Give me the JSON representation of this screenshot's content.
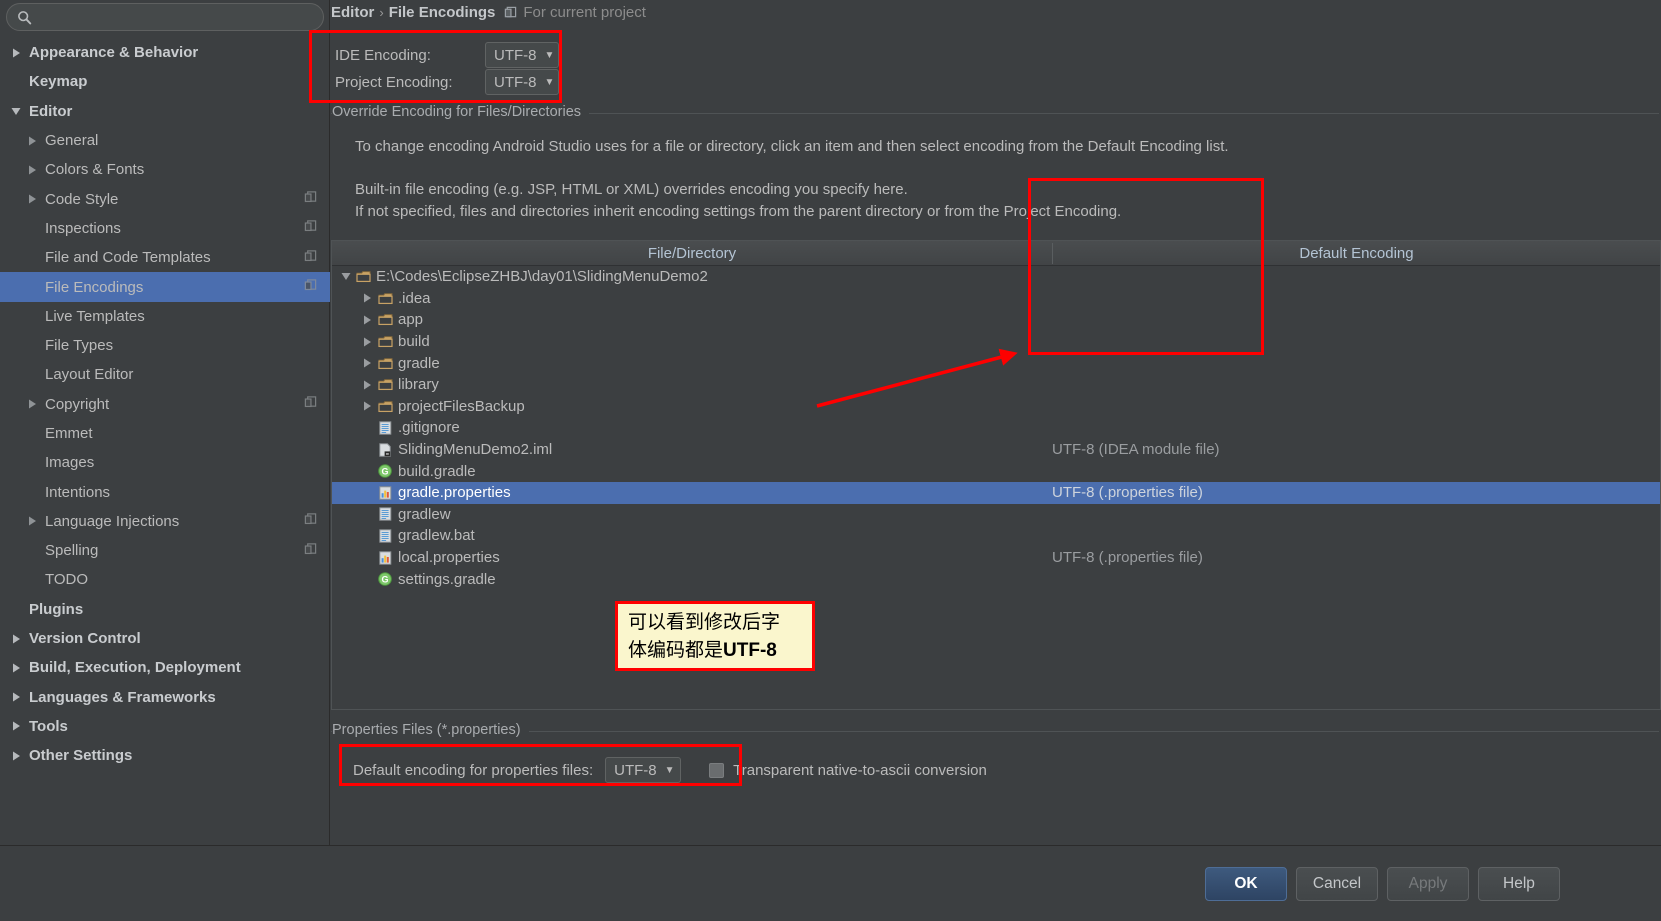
{
  "search": {
    "value": "",
    "placeholder": "",
    "icon": "search-icon"
  },
  "sidebar": {
    "items": [
      {
        "label": "Appearance & Behavior",
        "level": 0,
        "arrow": "right",
        "bold": true,
        "badge": false
      },
      {
        "label": "Keymap",
        "level": 0,
        "arrow": "none",
        "bold": true,
        "badge": false
      },
      {
        "label": "Editor",
        "level": 0,
        "arrow": "down",
        "bold": true,
        "badge": false
      },
      {
        "label": "General",
        "level": 1,
        "arrow": "right",
        "bold": false,
        "badge": false
      },
      {
        "label": "Colors & Fonts",
        "level": 1,
        "arrow": "right",
        "bold": false,
        "badge": false
      },
      {
        "label": "Code Style",
        "level": 1,
        "arrow": "right",
        "bold": false,
        "badge": true
      },
      {
        "label": "Inspections",
        "level": 1,
        "arrow": "none",
        "bold": false,
        "badge": true
      },
      {
        "label": "File and Code Templates",
        "level": 1,
        "arrow": "none",
        "bold": false,
        "badge": true
      },
      {
        "label": "File Encodings",
        "level": 1,
        "arrow": "none",
        "bold": false,
        "badge": true,
        "selected": true
      },
      {
        "label": "Live Templates",
        "level": 1,
        "arrow": "none",
        "bold": false,
        "badge": false
      },
      {
        "label": "File Types",
        "level": 1,
        "arrow": "none",
        "bold": false,
        "badge": false
      },
      {
        "label": "Layout Editor",
        "level": 1,
        "arrow": "none",
        "bold": false,
        "badge": false
      },
      {
        "label": "Copyright",
        "level": 1,
        "arrow": "right",
        "bold": false,
        "badge": true
      },
      {
        "label": "Emmet",
        "level": 1,
        "arrow": "none",
        "bold": false,
        "badge": false
      },
      {
        "label": "Images",
        "level": 1,
        "arrow": "none",
        "bold": false,
        "badge": false
      },
      {
        "label": "Intentions",
        "level": 1,
        "arrow": "none",
        "bold": false,
        "badge": false
      },
      {
        "label": "Language Injections",
        "level": 1,
        "arrow": "right",
        "bold": false,
        "badge": true
      },
      {
        "label": "Spelling",
        "level": 1,
        "arrow": "none",
        "bold": false,
        "badge": true
      },
      {
        "label": "TODO",
        "level": 1,
        "arrow": "none",
        "bold": false,
        "badge": false
      },
      {
        "label": "Plugins",
        "level": 0,
        "arrow": "none",
        "bold": true,
        "badge": false
      },
      {
        "label": "Version Control",
        "level": 0,
        "arrow": "right",
        "bold": true,
        "badge": false
      },
      {
        "label": "Build, Execution, Deployment",
        "level": 0,
        "arrow": "right",
        "bold": true,
        "badge": false
      },
      {
        "label": "Languages & Frameworks",
        "level": 0,
        "arrow": "right",
        "bold": true,
        "badge": false
      },
      {
        "label": "Tools",
        "level": 0,
        "arrow": "right",
        "bold": true,
        "badge": false
      },
      {
        "label": "Other Settings",
        "level": 0,
        "arrow": "right",
        "bold": true,
        "badge": false
      }
    ]
  },
  "breadcrumb": {
    "parent": "Editor",
    "separator": "›",
    "current": "File Encodings",
    "scope": "For current project",
    "scope_icon": "project-scope-icon"
  },
  "encoding_form": {
    "ide_label": "IDE Encoding:",
    "ide_value": "UTF-8",
    "project_label": "Project Encoding:",
    "project_value": "UTF-8",
    "caret": "▼"
  },
  "override_group": {
    "title": "Override Encoding for Files/Directories",
    "paragraphs": [
      "To change encoding Android Studio uses for a file or directory, click an item and then select encoding from the Default Encoding list.",
      "Built-in file encoding (e.g. JSP, HTML or XML) overrides encoding you specify here.",
      "If not specified, files and directories inherit encoding settings from the parent directory or from the Project Encoding."
    ]
  },
  "table": {
    "columns": [
      "File/Directory",
      "Default Encoding"
    ],
    "rows": [
      {
        "name": "E:\\Codes\\EclipseZHBJ\\day01\\SlidingMenuDemo2",
        "indent": 0,
        "arrow": "down",
        "icon": "folder-icon",
        "encoding": ""
      },
      {
        "name": ".idea",
        "indent": 1,
        "arrow": "right",
        "icon": "folder-icon",
        "encoding": ""
      },
      {
        "name": "app",
        "indent": 1,
        "arrow": "right",
        "icon": "folder-icon",
        "encoding": ""
      },
      {
        "name": "build",
        "indent": 1,
        "arrow": "right",
        "icon": "folder-icon",
        "encoding": ""
      },
      {
        "name": "gradle",
        "indent": 1,
        "arrow": "right",
        "icon": "folder-icon",
        "encoding": ""
      },
      {
        "name": "library",
        "indent": 1,
        "arrow": "right",
        "icon": "folder-icon",
        "encoding": ""
      },
      {
        "name": "projectFilesBackup",
        "indent": 1,
        "arrow": "right",
        "icon": "folder-icon",
        "encoding": ""
      },
      {
        "name": ".gitignore",
        "indent": 1,
        "arrow": "none",
        "icon": "text-file-icon",
        "encoding": ""
      },
      {
        "name": "SlidingMenuDemo2.iml",
        "indent": 1,
        "arrow": "none",
        "icon": "module-file-icon",
        "encoding": "UTF-8 (IDEA module file)"
      },
      {
        "name": "build.gradle",
        "indent": 1,
        "arrow": "none",
        "icon": "gradle-icon",
        "encoding": ""
      },
      {
        "name": "gradle.properties",
        "indent": 1,
        "arrow": "none",
        "icon": "properties-file-icon",
        "encoding": "UTF-8 (.properties file)",
        "selected": true
      },
      {
        "name": "gradlew",
        "indent": 1,
        "arrow": "none",
        "icon": "text-file-icon",
        "encoding": ""
      },
      {
        "name": "gradlew.bat",
        "indent": 1,
        "arrow": "none",
        "icon": "text-file-icon",
        "encoding": ""
      },
      {
        "name": "local.properties",
        "indent": 1,
        "arrow": "none",
        "icon": "properties-file-icon",
        "encoding": "UTF-8 (.properties file)"
      },
      {
        "name": "settings.gradle",
        "indent": 1,
        "arrow": "none",
        "icon": "gradle-icon",
        "encoding": ""
      }
    ]
  },
  "properties_group": {
    "title": "Properties Files (*.properties)",
    "default_encoding_label": "Default encoding for properties files:",
    "default_encoding_value": "UTF-8",
    "checkbox_label": "Transparent native-to-ascii conversion",
    "checkbox_checked": false
  },
  "annotation": {
    "line1": "可以看到修改后字",
    "line2_pre": "体编码都是",
    "line2_bold": "UTF-8"
  },
  "buttons": {
    "ok": "OK",
    "cancel": "Cancel",
    "apply": "Apply",
    "help": "Help"
  },
  "colors": {
    "accent": "#4b6eaf",
    "highlight_red": "#fe0000",
    "annotation_bg": "#faf6cd",
    "background": "#3c3f41",
    "folder": "#d4a75f",
    "gradle_green": "#6aa84f"
  }
}
